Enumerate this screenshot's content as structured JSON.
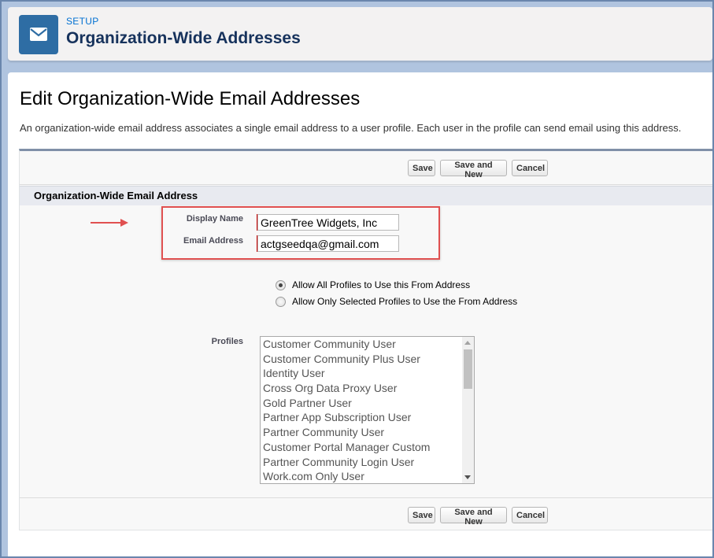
{
  "header": {
    "section_label": "SETUP",
    "title": "Organization-Wide Addresses",
    "icon": "email-icon"
  },
  "page": {
    "title": "Edit Organization-Wide Email Addresses",
    "description": "An organization-wide email address associates a single email address to a user profile. Each user in the profile can send email using this address."
  },
  "buttons": {
    "save": "Save",
    "save_and_new": "Save and New",
    "cancel": "Cancel"
  },
  "section": {
    "title": "Organization-Wide Email Address"
  },
  "form": {
    "display_name_label": "Display Name",
    "display_name_value": "GreenTree Widgets, Inc",
    "email_label": "Email Address",
    "email_value": "actgseedqa@gmail.com",
    "radio_all": "Allow All Profiles to Use this From Address",
    "radio_selected": "Allow Only Selected Profiles to Use the From Address",
    "radio_selected_option": "all",
    "profiles_label": "Profiles",
    "profiles": [
      "Customer Community User",
      "Customer Community Plus User",
      "Identity User",
      "Cross Org Data Proxy User",
      "Gold Partner User",
      "Partner App Subscription User",
      "Partner Community User",
      "Customer Portal Manager Custom",
      "Partner Community Login User",
      "Work.com Only User"
    ]
  },
  "colors": {
    "header_icon_bg": "#2e6da4",
    "highlight_box": "#e05050",
    "required_marker": "#cc0000",
    "accent_link": "#0070d2"
  }
}
